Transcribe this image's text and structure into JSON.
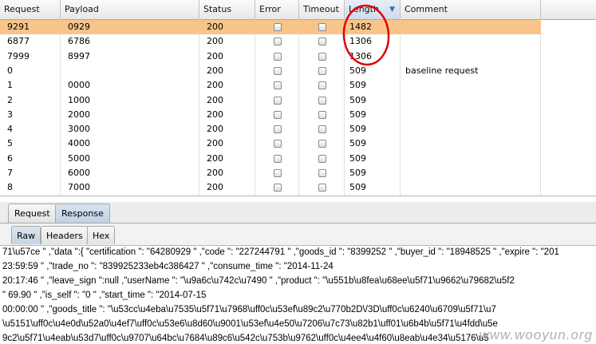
{
  "table": {
    "columns": [
      {
        "key": "request",
        "label": "Request"
      },
      {
        "key": "payload",
        "label": "Payload"
      },
      {
        "key": "status",
        "label": "Status"
      },
      {
        "key": "error",
        "label": "Error"
      },
      {
        "key": "timeout",
        "label": "Timeout"
      },
      {
        "key": "length",
        "label": "Length",
        "sorted": "desc"
      },
      {
        "key": "comment",
        "label": "Comment"
      }
    ],
    "rows": [
      {
        "request": "9291",
        "payload": "0929",
        "status": "200",
        "error": false,
        "timeout": false,
        "length": "1482",
        "comment": "",
        "selected": true
      },
      {
        "request": "6877",
        "payload": "6786",
        "status": "200",
        "error": false,
        "timeout": false,
        "length": "1306",
        "comment": ""
      },
      {
        "request": "7999",
        "payload": "8997",
        "status": "200",
        "error": false,
        "timeout": false,
        "length": "1306",
        "comment": ""
      },
      {
        "request": "0",
        "payload": "",
        "status": "200",
        "error": false,
        "timeout": false,
        "length": "509",
        "comment": "baseline request"
      },
      {
        "request": "1",
        "payload": "0000",
        "status": "200",
        "error": false,
        "timeout": false,
        "length": "509",
        "comment": ""
      },
      {
        "request": "2",
        "payload": "1000",
        "status": "200",
        "error": false,
        "timeout": false,
        "length": "509",
        "comment": ""
      },
      {
        "request": "3",
        "payload": "2000",
        "status": "200",
        "error": false,
        "timeout": false,
        "length": "509",
        "comment": ""
      },
      {
        "request": "4",
        "payload": "3000",
        "status": "200",
        "error": false,
        "timeout": false,
        "length": "509",
        "comment": ""
      },
      {
        "request": "5",
        "payload": "4000",
        "status": "200",
        "error": false,
        "timeout": false,
        "length": "509",
        "comment": ""
      },
      {
        "request": "6",
        "payload": "5000",
        "status": "200",
        "error": false,
        "timeout": false,
        "length": "509",
        "comment": ""
      },
      {
        "request": "7",
        "payload": "6000",
        "status": "200",
        "error": false,
        "timeout": false,
        "length": "509",
        "comment": ""
      },
      {
        "request": "8",
        "payload": "7000",
        "status": "200",
        "error": false,
        "timeout": false,
        "length": "509",
        "comment": ""
      }
    ],
    "selected_row_color": "#f8c48a",
    "annotation_color": "#e00000",
    "sort_arrow_icon": "sort-descending-arrow"
  },
  "tabs": {
    "request": "Request",
    "response": "Response",
    "active": "response"
  },
  "subtabs": {
    "raw": "Raw",
    "headers": "Headers",
    "hex": "Hex",
    "active": "raw"
  },
  "response_lines": [
    "71\\u57ce \" ,\"data \":{ \"certification \": \"64280929 \" ,\"code \": \"227244791 \" ,\"goods_id \": \"8399252 \" ,\"buyer_id \": \"18948525 \" ,\"expire \": \"201",
    "23:59:59 \" ,\"trade_no \": \"839925233eb4c386427 \" ,\"consume_time \": \"2014-11-24",
    "20:17:46 \" ,\"leave_sign \":null ,\"userName \": \"\\u9a6c\\u742c\\u7490 \" ,\"product \": \"\\u551b\\u8fea\\u68ee\\u5f71\\u9662\\u79682\\u5f2",
    "\" 69.90 \" ,\"is_self \": \"0 \" ,\"start_time \": \"2014-07-15",
    "00:00:00 \" ,\"goods_title \": \"\\u53cc\\u4eba\\u7535\\u5f71\\u7968\\uff0c\\u53ef\\u89c2\\u770b2D\\/3D\\uff0c\\u6240\\u6709\\u5f71\\u7",
    "\\u5151\\uff0c\\u4e0d\\u52a0\\u4ef7\\uff0c\\u53e6\\u8d60\\u9001\\u53ef\\u4e50\\u7206\\u7c73\\u82b1\\uff01\\u6b4b\\u5f71\\u4fdd\\u5e",
    "9c2\\u5f71\\u4eab\\u53d7\\uff0c\\u9707\\u64bc\\u7684\\u89c6\\u542c\\u753b\\u9762\\uff0c\\u4ee4\\u4f60\\u8eab\\u4e34\\u5176\\u5"
  ],
  "watermark": "www.wooyun.org"
}
